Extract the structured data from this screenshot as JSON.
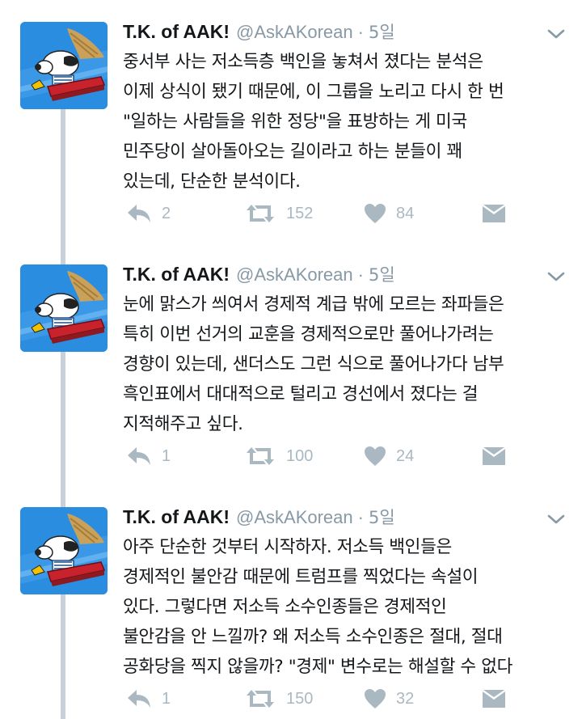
{
  "tweets": [
    {
      "name": "T.K. of AAK!",
      "handle": "@AskAKorean",
      "separator": "·",
      "time": "5일",
      "lines": [
        "중서부 사는 저소득층 백인을 놓쳐서 졌다는 분석은",
        "이제 상식이 됐기 때문에, 이 그룹을 노리고 다시 한 번",
        "\"일하는 사람들을 위한 정당\"을 표방하는 게 미국",
        "민주당이 살아돌아오는 길이라고 하는 분들이 꽤",
        "있는데, 단순한 분석이다."
      ],
      "replies": "2",
      "retweets": "152",
      "likes": "84"
    },
    {
      "name": "T.K. of AAK!",
      "handle": "@AskAKorean",
      "separator": "·",
      "time": "5일",
      "lines": [
        "눈에 맑스가 씌여서 경제적 계급 밖에 모르는 좌파들은",
        "특히 이번 선거의 교훈을 경제적으로만 풀어나가려는",
        "경향이 있는데, 샌더스도 그런 식으로 풀어나가다 남부",
        "흑인표에서 대대적으로 털리고 경선에서 졌다는 걸",
        "지적해주고 싶다."
      ],
      "replies": "1",
      "retweets": "100",
      "likes": "24"
    },
    {
      "name": "T.K. of AAK!",
      "handle": "@AskAKorean",
      "separator": "·",
      "time": "5일",
      "lines": [
        "아주 단순한 것부터 시작하자. 저소득 백인들은",
        "경제적인 불안감 때문에 트럼프를 찍었다는 속설이",
        "있다. 그렇다면 저소득 소수인종들은 경제적인",
        "불안감을 안 느낄까? 왜 저소득 소수인종은 절대, 절대",
        "공화당을 찍지 않을까? \"경제\" 변수로는 해설할 수 없다"
      ],
      "replies": "1",
      "retweets": "150",
      "likes": "32"
    }
  ],
  "icons": {
    "reply": "reply-icon",
    "retweet": "retweet-icon",
    "like": "heart-icon",
    "message": "envelope-icon",
    "more": "chevron-down-icon",
    "avatar": "snoopy-avatar"
  },
  "colors": {
    "text": "#14171a",
    "muted": "#8899a6",
    "action": "#aab8c2",
    "thread_line": "#c8d1d9",
    "avatar_bg": "#2a8de0"
  }
}
